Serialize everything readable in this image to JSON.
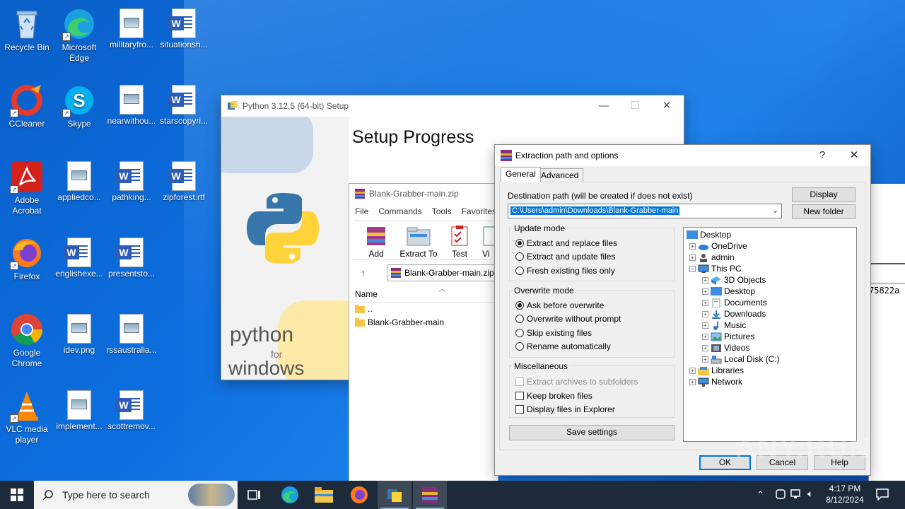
{
  "desktop": {
    "icons": [
      {
        "label": "Recycle Bin"
      },
      {
        "label": "Microsoft Edge"
      },
      {
        "label": "militaryfro..."
      },
      {
        "label": "situationsh..."
      },
      {
        "label": "CCleaner"
      },
      {
        "label": "Skype"
      },
      {
        "label": "nearwithou..."
      },
      {
        "label": "starscopyri..."
      },
      {
        "label": "Adobe Acrobat"
      },
      {
        "label": "appliedco..."
      },
      {
        "label": "pathking..."
      },
      {
        "label": "zipforest.rtf"
      },
      {
        "label": "Firefox"
      },
      {
        "label": "englishexe..."
      },
      {
        "label": "presentsto..."
      },
      {
        "label": "Google Chrome"
      },
      {
        "label": "idev.png"
      },
      {
        "label": "rssaustralia..."
      },
      {
        "label": "VLC media player"
      },
      {
        "label": "implement..."
      },
      {
        "label": "scottremov..."
      }
    ]
  },
  "python_setup": {
    "title": "Python 3.12.5 (64-bit) Setup",
    "heading": "Setup Progress",
    "logo_text_1": "python",
    "logo_text_2": "for",
    "logo_text_3": "windows"
  },
  "winrar": {
    "title": "Blank-Grabber-main.zip",
    "menu": [
      "File",
      "Commands",
      "Tools",
      "Favorites"
    ],
    "toolbar": [
      "Add",
      "Extract To",
      "Test",
      "Vi"
    ],
    "address": "Blank-Grabber-main.zip",
    "column_name": "Name",
    "files": [
      "..",
      "Blank-Grabber-main"
    ]
  },
  "background_console": {
    "text": "75822a"
  },
  "dialog": {
    "title": "Extraction path and options",
    "help": "?",
    "close": "✕",
    "tabs": [
      "General",
      "Advanced"
    ],
    "dest_label": "Destination path (will be created if does not exist)",
    "dest_value": "C:\\Users\\admin\\Downloads\\Blank-Grabber-main",
    "display_btn": "Display",
    "new_folder_btn": "New folder",
    "update_mode": {
      "label": "Update mode",
      "options": [
        "Extract and replace files",
        "Extract and update files",
        "Fresh existing files only"
      ],
      "selected": 0
    },
    "overwrite_mode": {
      "label": "Overwrite mode",
      "options": [
        "Ask before overwrite",
        "Overwrite without prompt",
        "Skip existing files",
        "Rename automatically"
      ],
      "selected": 0
    },
    "misc": {
      "label": "Miscellaneous",
      "options": [
        "Extract archives to subfolders",
        "Keep broken files",
        "Display files in Explorer"
      ]
    },
    "save_settings": "Save settings",
    "tree": [
      "Desktop",
      "OneDrive",
      "admin",
      "This PC",
      "3D Objects",
      "Desktop",
      "Documents",
      "Downloads",
      "Music",
      "Pictures",
      "Videos",
      "Local Disk (C:)",
      "Libraries",
      "Network"
    ],
    "ok": "OK",
    "cancel": "Cancel",
    "help_btn": "Help"
  },
  "taskbar": {
    "search_placeholder": "Type here to search",
    "time": "4:17 PM",
    "date": "8/12/2024"
  },
  "watermark": "ANY.RUN"
}
